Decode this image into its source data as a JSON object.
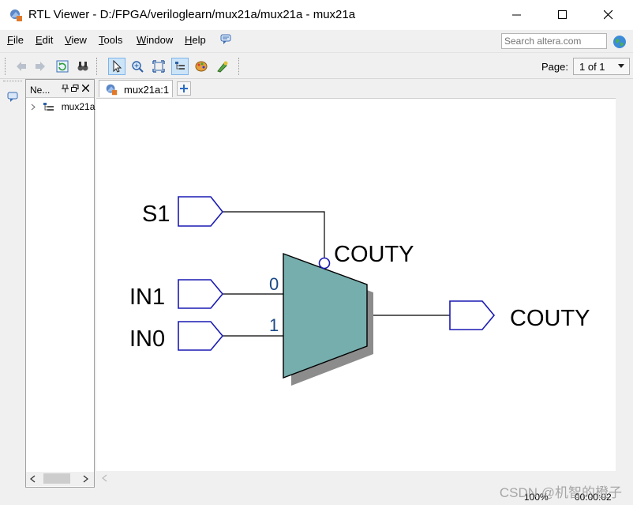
{
  "window": {
    "title": "RTL Viewer - D:/FPGA/veriloglearn/mux21a/mux21a - mux21a",
    "app_icon": "rtl-viewer-icon",
    "controls": [
      "minimize-icon",
      "maximize-icon",
      "close-icon"
    ]
  },
  "menu": {
    "items": [
      {
        "label": "File",
        "mnemonic": "F",
        "rest": "ile"
      },
      {
        "label": "Edit",
        "mnemonic": "E",
        "rest": "dit"
      },
      {
        "label": "View",
        "mnemonic": "V",
        "rest": "iew"
      },
      {
        "label": "Tools",
        "mnemonic": "T",
        "rest": "ools"
      },
      {
        "label": "Window",
        "mnemonic": "W",
        "rest": "indow"
      },
      {
        "label": "Help",
        "mnemonic": "H",
        "rest": "elp"
      }
    ],
    "search_placeholder": "Search altera.com"
  },
  "toolbar": {
    "buttons": [
      "back-icon",
      "forward-icon",
      "refresh-icon",
      "find-icon",
      "select-icon",
      "zoom-icon",
      "fit-icon",
      "netlist-icon",
      "color-icon",
      "hierarchy-icon"
    ],
    "page_label": "Page:",
    "page_value": "1 of 1"
  },
  "navigator": {
    "title": "Ne...",
    "tree_item": "mux21a"
  },
  "tab": {
    "label": "mux21a:1"
  },
  "schematic": {
    "inputs": [
      "S1",
      "IN1",
      "IN0"
    ],
    "mux_inputs": [
      "0",
      "1"
    ],
    "mux_name": "COUTY",
    "output": "COUTY",
    "mux_fill": "#76adad",
    "port_color": "#1a1ab4"
  },
  "status": {
    "zoom": "100%",
    "time": "00:00:02"
  },
  "watermark": "CSDN @机智的橙子"
}
